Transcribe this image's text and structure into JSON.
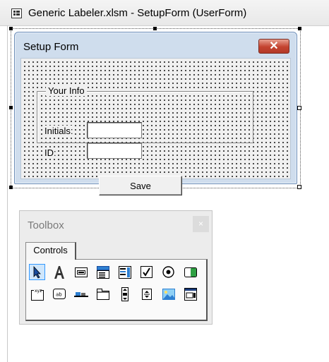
{
  "window": {
    "title": "Generic Labeler.xlsm - SetupForm (UserForm)"
  },
  "form": {
    "caption": "Setup Form",
    "close_glyph": "✕",
    "frame": {
      "caption": "Your Info",
      "initials_label": "Initials:",
      "id_label": "ID:",
      "initials_value": "",
      "id_value": ""
    },
    "save_label": "Save"
  },
  "toolbox": {
    "title": "Toolbox",
    "close_glyph": "×",
    "tab_label": "Controls",
    "tools": [
      "select-objects",
      "label",
      "textbox",
      "combobox",
      "listbox",
      "checkbox",
      "optionbutton",
      "togglebutton",
      "frame",
      "commandbutton",
      "tabstrip",
      "multipage",
      "scrollbar",
      "spinbutton",
      "image",
      "refedit"
    ]
  },
  "colors": {
    "form_frame": "#cfdded",
    "close_button": "#c4432f",
    "canvas": "#f0f0f0",
    "tool_selected": "#cfe6fb"
  }
}
